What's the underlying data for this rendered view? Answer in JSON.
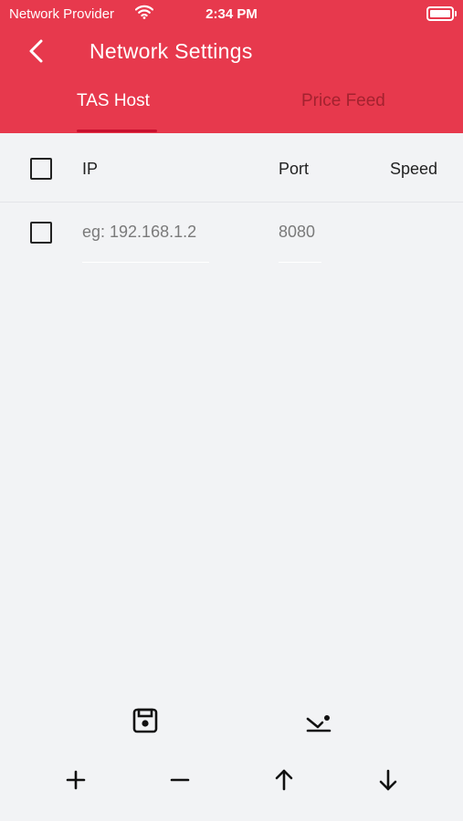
{
  "status_bar": {
    "carrier": "Network Provider",
    "time": "2:34 PM"
  },
  "header": {
    "title": "Network Settings",
    "background_color": "#e7394d"
  },
  "tabs": [
    {
      "label": "TAS Host",
      "active": true
    },
    {
      "label": "Price Feed",
      "active": false
    }
  ],
  "table": {
    "columns": [
      "IP",
      "Port",
      "Speed"
    ],
    "rows": [
      {
        "checked": false,
        "ip_placeholder": "eg: 192.168.1.2",
        "ip_value": "",
        "port_value": "8080",
        "speed": ""
      }
    ]
  },
  "toolbar": {
    "icons": [
      "save-icon",
      "import-icon",
      "add-icon",
      "remove-icon",
      "move-up-icon",
      "move-down-icon"
    ]
  }
}
